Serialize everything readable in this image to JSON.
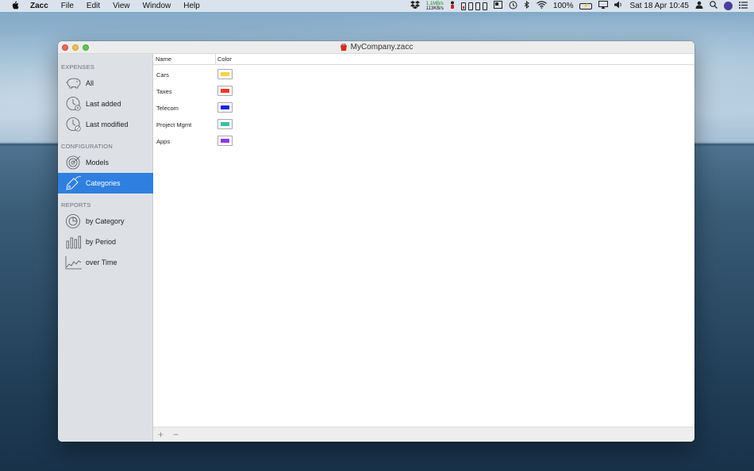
{
  "menubar": {
    "app_name": "Zacc",
    "menus": [
      "File",
      "Edit",
      "View",
      "Window",
      "Help"
    ],
    "network_up": "1,1MB/s",
    "network_down": "113KB/s",
    "battery_percent": "100%",
    "battery_glyph": "⚡",
    "datetime": "Sat 18 Apr  10:45"
  },
  "window": {
    "title": "MyCompany.zacc"
  },
  "sidebar": {
    "sections": [
      {
        "title": "EXPENSES",
        "items": [
          {
            "label": "All",
            "icon": "piggy-bank-icon"
          },
          {
            "label": "Last added",
            "icon": "clock-add-icon"
          },
          {
            "label": "Last modified",
            "icon": "clock-edit-icon"
          }
        ]
      },
      {
        "title": "CONFIGURATION",
        "items": [
          {
            "label": "Models",
            "icon": "target-icon"
          },
          {
            "label": "Categories",
            "icon": "tag-icon",
            "selected": true
          }
        ]
      },
      {
        "title": "REPORTS",
        "items": [
          {
            "label": "by Category",
            "icon": "pie-chart-icon"
          },
          {
            "label": "by Period",
            "icon": "bar-chart-icon"
          },
          {
            "label": "over Time",
            "icon": "line-chart-icon"
          }
        ]
      }
    ]
  },
  "table": {
    "columns": [
      "Name",
      "Color"
    ],
    "rows": [
      {
        "name": "Cars",
        "color": "#f3d34a"
      },
      {
        "name": "Taxes",
        "color": "#ec3a24"
      },
      {
        "name": "Telecom",
        "color": "#1a25e0"
      },
      {
        "name": "Project Mgmt",
        "color": "#3dbfa5"
      },
      {
        "name": "Apps",
        "color": "#8a3ae0"
      }
    ]
  },
  "bottombar": {
    "add_label": "+",
    "remove_label": "−"
  },
  "colors": {
    "accent": "#2f7fe0",
    "sidebar_bg": "#dde1e6"
  }
}
